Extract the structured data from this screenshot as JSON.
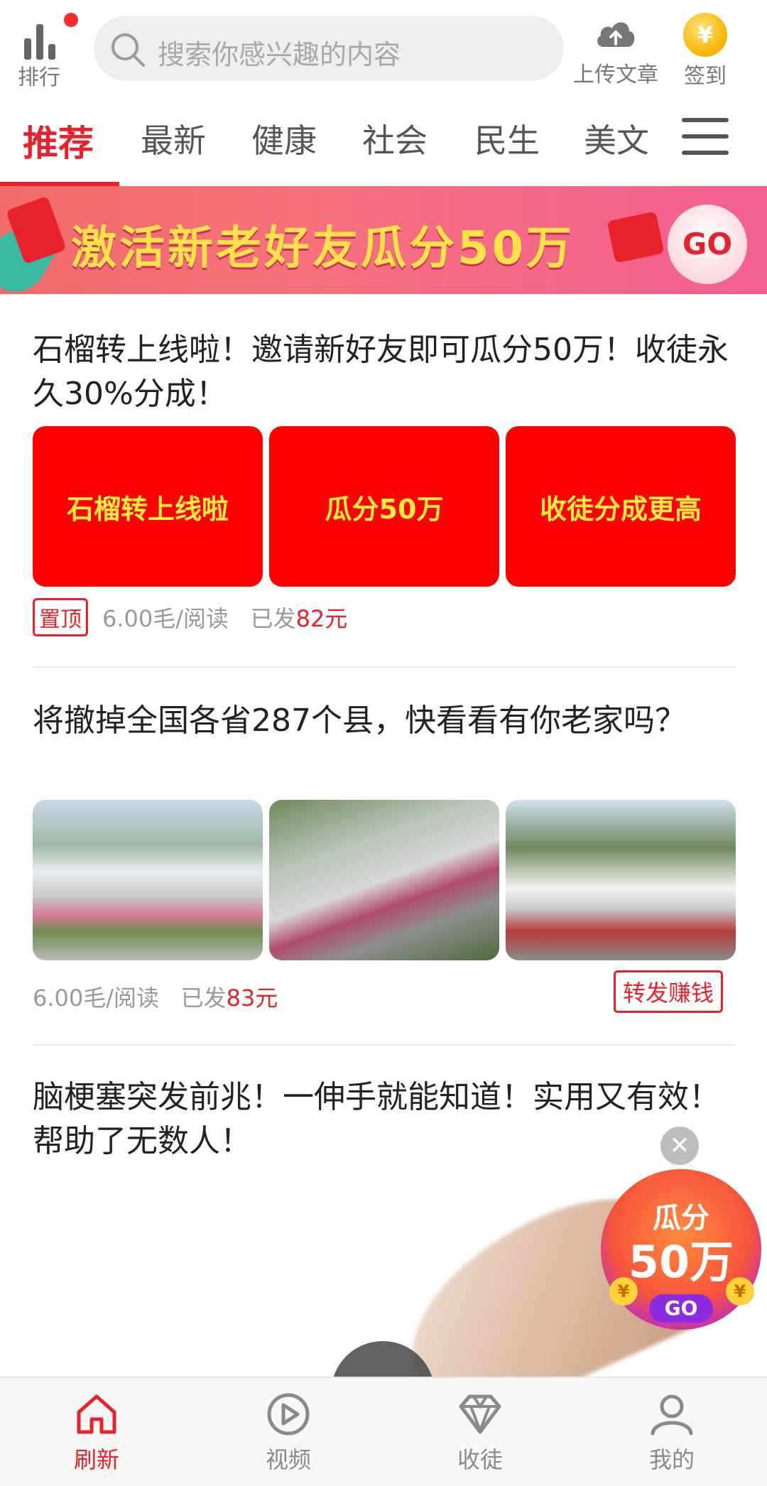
{
  "topbar": {
    "rank_label": "排行",
    "search_placeholder": "搜索你感兴趣的内容",
    "upload_label": "上传文章",
    "signin_label": "签到",
    "coin_symbol": "¥"
  },
  "tabs": [
    "推荐",
    "最新",
    "健康",
    "社会",
    "民生",
    "美文"
  ],
  "active_tab": 0,
  "banner": {
    "text": "激活新老好友瓜分50万",
    "go": "GO"
  },
  "articles": [
    {
      "title": "石榴转上线啦！邀请新好友即可瓜分50万！收徒永久30%分成！",
      "thumbs": [
        "石榴转上线啦",
        "瓜分50万",
        "收徒分成更高"
      ],
      "tag": "置顶",
      "rate": "6.00毛/阅读",
      "sent_prefix": "已发",
      "sent_amount": "82元"
    },
    {
      "title": "将撤掉全国各省287个县，快看看有你老家吗？",
      "rate": "6.00毛/阅读",
      "sent_prefix": "已发",
      "sent_amount": "83元",
      "share": "转发赚钱"
    },
    {
      "title": "脑梗塞突发前兆！一伸手就能知道！实用又有效！帮助了无数人！"
    }
  ],
  "float_badge": {
    "line1": "瓜分",
    "line2": "50万",
    "go": "GO",
    "coin": "¥",
    "close": "✕"
  },
  "bottom_nav": [
    {
      "label": "刷新",
      "icon": "home-icon"
    },
    {
      "label": "视频",
      "icon": "play-icon"
    },
    {
      "label": "收徒",
      "icon": "diamond-icon"
    },
    {
      "label": "我的",
      "icon": "user-icon"
    }
  ],
  "colors": {
    "accent": "#e8222a",
    "banner_text": "#ffe24a",
    "red_thumb": "#ff0000",
    "red_thumb_text": "#ffec3a"
  }
}
